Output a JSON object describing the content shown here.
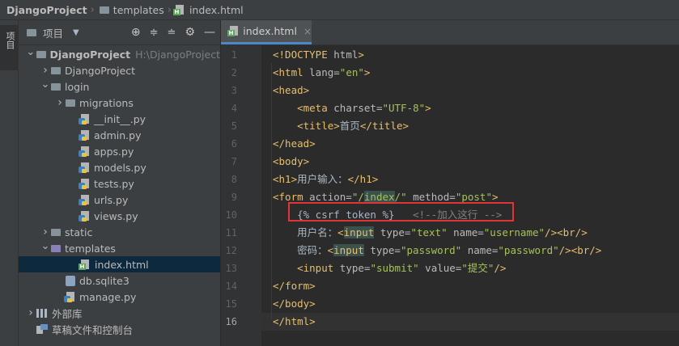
{
  "breadcrumb": {
    "project": "DjangoProject",
    "folder": "templates",
    "file": "index.html"
  },
  "side_strip": {
    "label": "项目"
  },
  "panel": {
    "title": "项目",
    "tree": [
      {
        "label": "DjangoProject",
        "extra": "H:\\DjangoProject",
        "kind": "folder",
        "depth": 0,
        "expanded": true
      },
      {
        "label": "DjangoProject",
        "kind": "folder",
        "depth": 1,
        "expanded": false
      },
      {
        "label": "login",
        "kind": "folder",
        "depth": 1,
        "expanded": true
      },
      {
        "label": "migrations",
        "kind": "folder",
        "depth": 2,
        "expanded": false
      },
      {
        "label": "__init__.py",
        "kind": "py",
        "depth": 3
      },
      {
        "label": "admin.py",
        "kind": "py",
        "depth": 3
      },
      {
        "label": "apps.py",
        "kind": "py",
        "depth": 3
      },
      {
        "label": "models.py",
        "kind": "py",
        "depth": 3
      },
      {
        "label": "tests.py",
        "kind": "py",
        "depth": 3
      },
      {
        "label": "urls.py",
        "kind": "py",
        "depth": 3
      },
      {
        "label": "views.py",
        "kind": "py",
        "depth": 3
      },
      {
        "label": "static",
        "kind": "folder",
        "depth": 1,
        "expanded": false
      },
      {
        "label": "templates",
        "kind": "folder-purple",
        "depth": 1,
        "expanded": true
      },
      {
        "label": "index.html",
        "kind": "html",
        "depth": 3,
        "selected": true
      },
      {
        "label": "db.sqlite3",
        "kind": "db",
        "depth": 2
      },
      {
        "label": "manage.py",
        "kind": "py",
        "depth": 2
      },
      {
        "label": "外部库",
        "kind": "lib",
        "depth": 0,
        "expanded": false
      },
      {
        "label": "草稿文件和控制台",
        "kind": "scratch",
        "depth": 0
      }
    ]
  },
  "editor": {
    "tab_label": "index.html",
    "current_line": 16,
    "lines": [
      [
        {
          "c": "t",
          "s": "<!DOCTYPE "
        },
        {
          "c": "a",
          "s": "html"
        },
        {
          "c": "t",
          "s": ">"
        }
      ],
      [
        {
          "c": "t",
          "s": "<html "
        },
        {
          "c": "a",
          "s": "lang="
        },
        {
          "c": "v",
          "s": "\"en\""
        },
        {
          "c": "t",
          "s": ">"
        }
      ],
      [
        {
          "c": "t",
          "s": "<head>"
        }
      ],
      [
        {
          "c": "txt",
          "s": "    "
        },
        {
          "c": "t",
          "s": "<meta "
        },
        {
          "c": "a",
          "s": "charset="
        },
        {
          "c": "v",
          "s": "\"UTF-8\""
        },
        {
          "c": "t",
          "s": ">"
        }
      ],
      [
        {
          "c": "txt",
          "s": "    "
        },
        {
          "c": "t",
          "s": "<title>"
        },
        {
          "c": "txt",
          "s": "首页"
        },
        {
          "c": "t",
          "s": "</title>"
        }
      ],
      [
        {
          "c": "t",
          "s": "</head>"
        }
      ],
      [
        {
          "c": "t",
          "s": "<body>"
        }
      ],
      [
        {
          "c": "t",
          "s": "<h1>"
        },
        {
          "c": "txt",
          "s": "用户输入："
        },
        {
          "c": "t",
          "s": "</h1>"
        }
      ],
      [
        {
          "c": "t",
          "s": "<form "
        },
        {
          "c": "a",
          "s": "action="
        },
        {
          "c": "v",
          "s": "\"/"
        },
        {
          "c": "vh",
          "s": "index"
        },
        {
          "c": "v",
          "s": "/\" "
        },
        {
          "c": "a",
          "s": "method="
        },
        {
          "c": "v",
          "s": "\"post\""
        },
        {
          "c": "t",
          "s": ">"
        }
      ],
      [
        {
          "c": "txt",
          "s": "    "
        },
        {
          "c": "tpl",
          "s": "{% csrf_token %}"
        },
        {
          "c": "txt",
          "s": "   "
        },
        {
          "c": "cm",
          "s": "<!--加入这行 -->"
        }
      ],
      [
        {
          "c": "txt",
          "s": "    用户名："
        },
        {
          "c": "t",
          "s": "<"
        },
        {
          "c": "th",
          "s": "input"
        },
        {
          "c": "t",
          "s": " "
        },
        {
          "c": "a",
          "s": "type="
        },
        {
          "c": "v",
          "s": "\"text\" "
        },
        {
          "c": "a",
          "s": "name="
        },
        {
          "c": "v",
          "s": "\"username\""
        },
        {
          "c": "t",
          "s": "/><br/>"
        }
      ],
      [
        {
          "c": "txt",
          "s": "    密码："
        },
        {
          "c": "t",
          "s": "<"
        },
        {
          "c": "th",
          "s": "input"
        },
        {
          "c": "t",
          "s": " "
        },
        {
          "c": "a",
          "s": "type="
        },
        {
          "c": "v",
          "s": "\"password\" "
        },
        {
          "c": "a",
          "s": "name="
        },
        {
          "c": "v",
          "s": "\"password\""
        },
        {
          "c": "t",
          "s": "/><br/>"
        }
      ],
      [
        {
          "c": "txt",
          "s": "    "
        },
        {
          "c": "t",
          "s": "<input "
        },
        {
          "c": "a",
          "s": "type="
        },
        {
          "c": "v",
          "s": "\"submit\" "
        },
        {
          "c": "a",
          "s": "value="
        },
        {
          "c": "v",
          "s": "\"提交\""
        },
        {
          "c": "t",
          "s": "/>"
        }
      ],
      [
        {
          "c": "t",
          "s": "</form>"
        }
      ],
      [
        {
          "c": "t",
          "s": "</body>"
        }
      ],
      [
        {
          "c": "t",
          "s": "</html>"
        }
      ]
    ]
  }
}
